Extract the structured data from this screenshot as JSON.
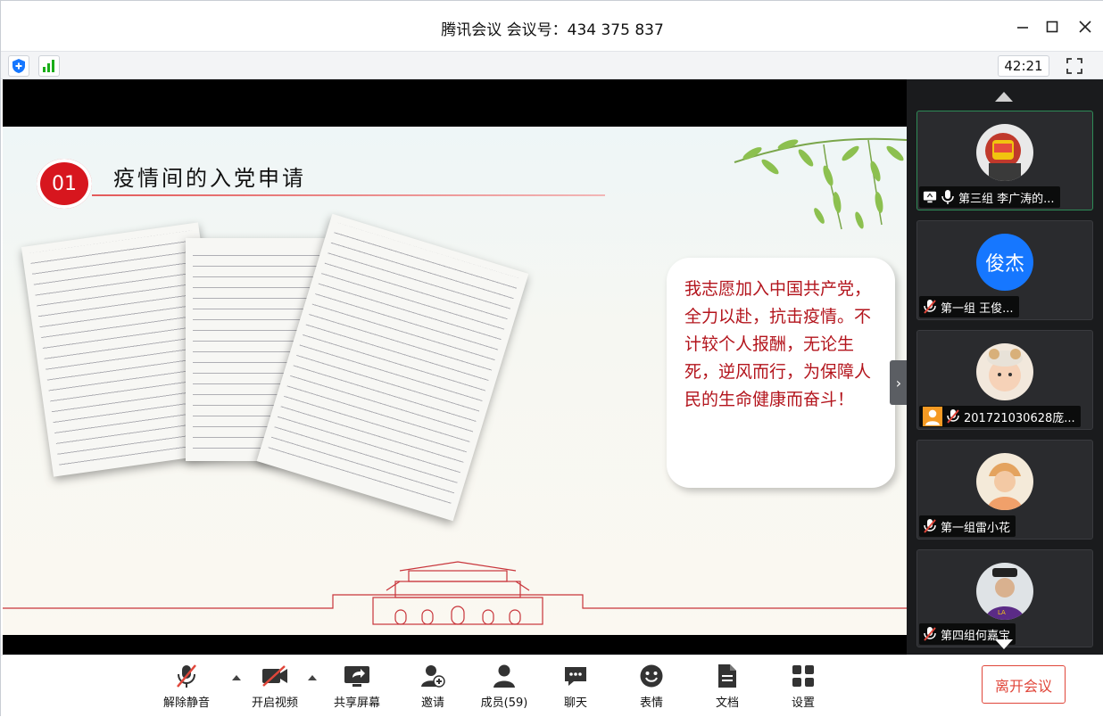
{
  "window": {
    "title": "腾讯会议 会议号：434 375 837",
    "timer": "42:21"
  },
  "colors": {
    "accent_red": "#d7161e",
    "leave_red": "#e0463a",
    "panel_bg": "#1a1b1d",
    "active_border": "#2e8b57",
    "signal_green": "#1aad19",
    "shield_blue": "#1677ff"
  },
  "icons": {
    "shield": "shield-icon",
    "signal": "signal-icon",
    "fullscreen": "fullscreen-icon",
    "minimize": "minimize-icon",
    "maximize": "maximize-icon",
    "close": "close-icon"
  },
  "slide": {
    "number": "01",
    "title": "疫情间的入党申请",
    "bubble_text": "我志愿加入中国共产党，全力以赴，抗击疫情。不计较个人报酬，无论生死，逆风而行，为保障人民的生命健康而奋斗！"
  },
  "participants": [
    {
      "name": "第三组 李广涛的...",
      "muted": false,
      "sharing": true,
      "avatar": "photo"
    },
    {
      "name": "第一组 王俊...",
      "muted": true,
      "sharing": false,
      "avatar": "text",
      "avatar_text": "俊杰"
    },
    {
      "name": "201721030628庞...",
      "muted": true,
      "sharing": false,
      "avatar": "photo",
      "badge": "user-icon"
    },
    {
      "name": "第一组雷小花",
      "muted": true,
      "sharing": false,
      "avatar": "photo"
    },
    {
      "name": "第四组何嘉宝",
      "muted": true,
      "sharing": false,
      "avatar": "photo"
    }
  ],
  "toolbar": {
    "unmute": "解除静音",
    "start_video": "开启视频",
    "share_screen": "共享屏幕",
    "invite": "邀请",
    "members": "成员(59)",
    "chat": "聊天",
    "emoji": "表情",
    "docs": "文档",
    "settings": "设置",
    "leave": "离开会议"
  }
}
